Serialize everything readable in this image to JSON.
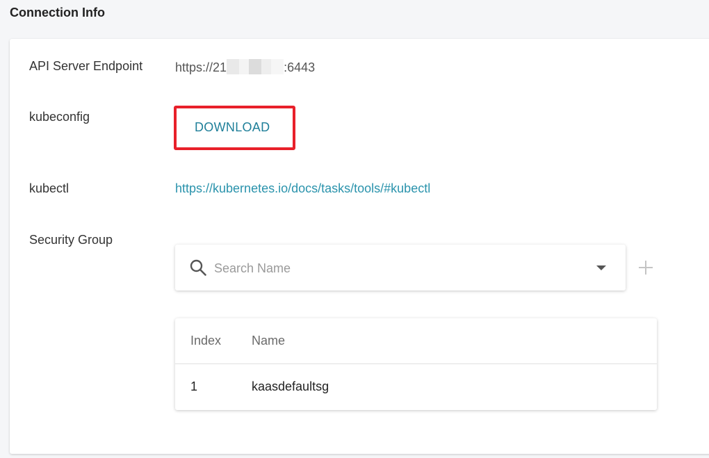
{
  "section": {
    "title": "Connection Info"
  },
  "fields": {
    "endpoint_label": "API Server Endpoint",
    "endpoint_prefix": "https://21",
    "endpoint_suffix": ":6443",
    "kubeconfig_label": "kubeconfig",
    "download_label": "DOWNLOAD",
    "kubectl_label": "kubectl",
    "kubectl_link": "https://kubernetes.io/docs/tasks/tools/#kubectl",
    "security_group_label": "Security Group"
  },
  "search": {
    "placeholder": "Search Name",
    "icon": "search-icon"
  },
  "table": {
    "columns": [
      "Index",
      "Name"
    ],
    "rows": [
      {
        "index": "1",
        "name": "kaasdefaultsg"
      }
    ]
  },
  "colors": {
    "link": "#2a93ac",
    "download": "#1f7f99",
    "highlight": "#e8202a"
  }
}
